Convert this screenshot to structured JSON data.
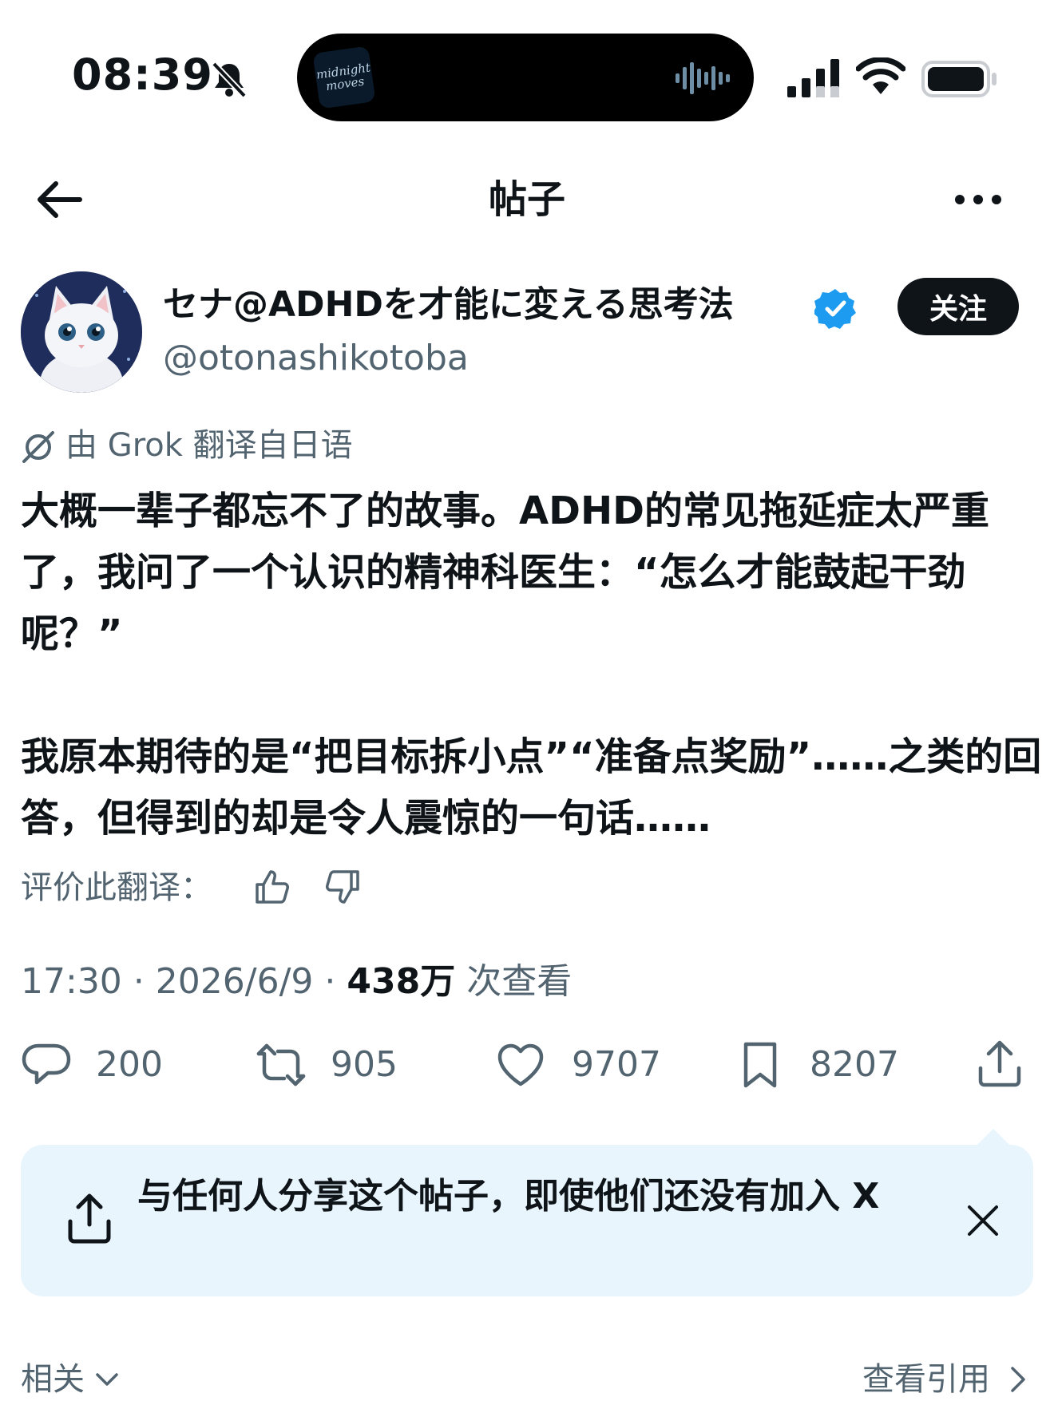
{
  "status_bar": {
    "time": "08:39",
    "album_art_text": "midnight moves"
  },
  "nav": {
    "title": "帖子"
  },
  "author": {
    "display_name": "セナ@ADHDを才能に変える思考法",
    "handle": "@otonashikotoba",
    "follow_label": "关注"
  },
  "translation": {
    "label": "由 Grok 翻译自日语",
    "rate_label": "评价此翻译："
  },
  "post": {
    "paragraph_1": "大概一辈子都忘不了的故事。ADHD的常见拖延症太严重了，我问了一个认识的精神科医生：“怎么才能鼓起干劲呢？”",
    "paragraph_2": "我原本期待的是“把目标拆小点”“准备点奖励”……之类的回答，但得到的却是令人震惊的一句话……"
  },
  "meta": {
    "time": "17:30",
    "date": "2026/6/9",
    "views_count": "438万",
    "views_label": "次查看"
  },
  "actions": {
    "replies": "200",
    "reposts": "905",
    "likes": "9707",
    "bookmarks": "8207"
  },
  "share_banner": {
    "text": "与任何人分享这个帖子，即使他们还没有加入 X"
  },
  "footer": {
    "related_label": "相关",
    "quotes_label": "查看引用"
  },
  "colors": {
    "text": "#0f1419",
    "secondary": "#536471",
    "verified": "#1d9bf0",
    "banner_bg": "#e8f5fd"
  }
}
